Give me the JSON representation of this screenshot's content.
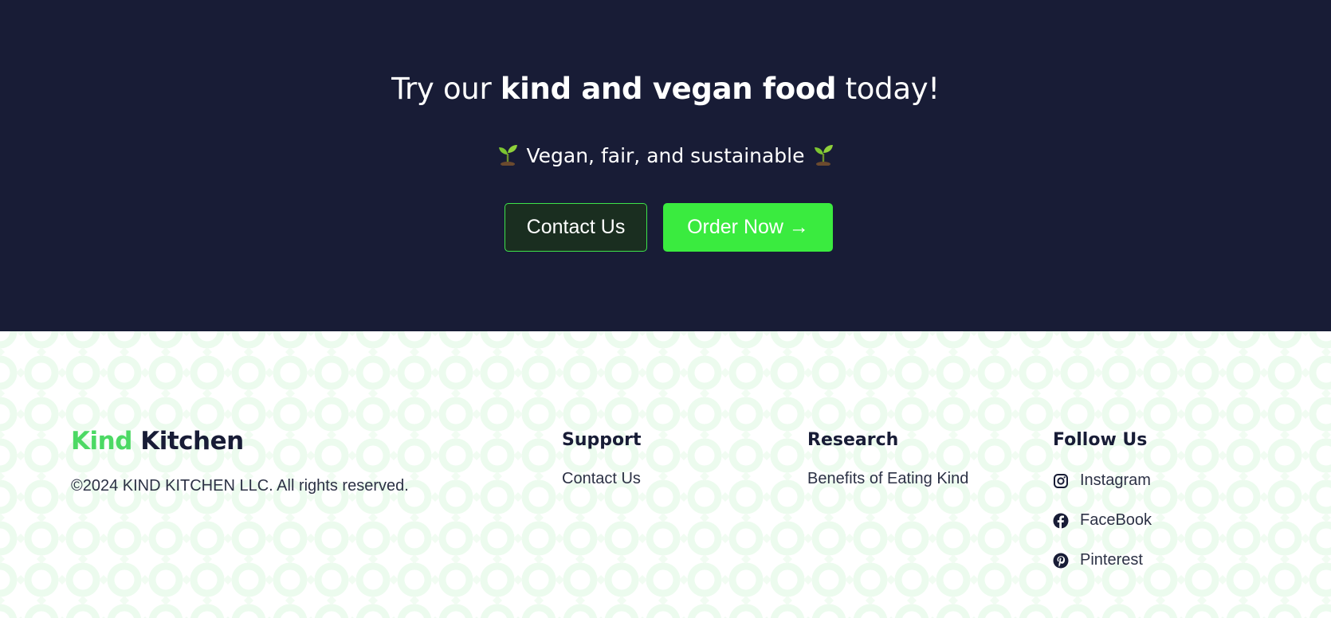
{
  "cta": {
    "title_pre": "Try our ",
    "title_bold": "kind and vegan food",
    "title_post": " today!",
    "subtitle": "Vegan, fair, and sustainable",
    "contact_label": "Contact Us",
    "order_label": "Order Now →"
  },
  "footer": {
    "brand_kind": "Kind",
    "brand_kitchen": "Kitchen",
    "copyright": "©2024 KIND KITCHEN LLC. All rights reserved.",
    "support": {
      "heading": "Support",
      "links": [
        "Contact Us"
      ]
    },
    "research": {
      "heading": "Research",
      "links": [
        "Benefits of Eating Kind"
      ]
    },
    "follow": {
      "heading": "Follow Us",
      "links": [
        {
          "label": "Instagram",
          "icon": "instagram-icon"
        },
        {
          "label": "FaceBook",
          "icon": "facebook-icon"
        },
        {
          "label": "Pinterest",
          "icon": "pinterest-icon"
        }
      ]
    }
  },
  "colors": {
    "dark_navy": "#181c36",
    "brand_green": "#4cd964",
    "order_green": "#3aeb3f",
    "contact_bg": "#1a2e20"
  }
}
